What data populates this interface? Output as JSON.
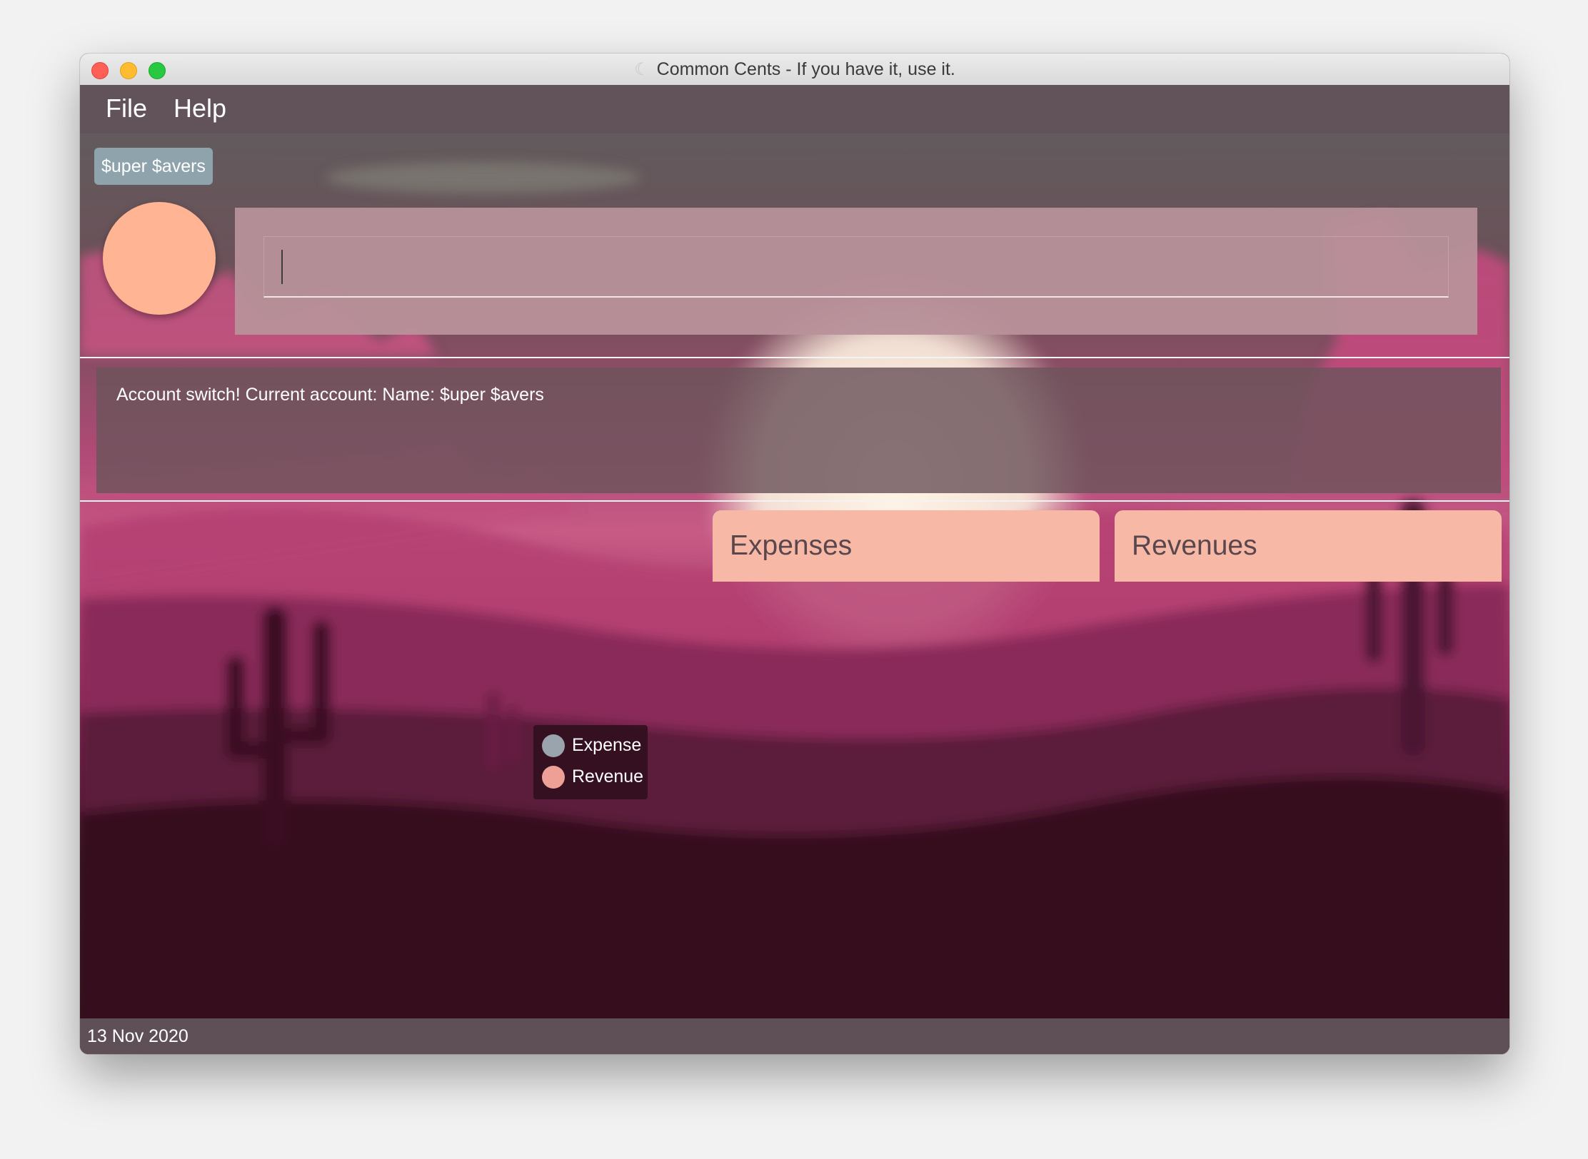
{
  "window": {
    "title": "Common Cents - If you have it, use it."
  },
  "menu": {
    "file": "File",
    "help": "Help"
  },
  "account": {
    "name": "$uper $avers"
  },
  "command": {
    "value": ""
  },
  "result": {
    "message": "Account switch! Current account: Name: $uper $avers"
  },
  "lists": {
    "expenses_header": "Expenses",
    "revenues_header": "Revenues"
  },
  "legend": {
    "items": [
      {
        "label": "Expense",
        "color": "#9aa4ac"
      },
      {
        "label": "Revenue",
        "color": "#eea097"
      }
    ]
  },
  "status": {
    "date": "13 Nov 2020"
  },
  "colors": {
    "menubar": "#625259",
    "account_tag": "#8fa3ad",
    "avatar": "#ffb493",
    "command_box": "#b8919a",
    "list_header": "#f8b8a6",
    "header_text": "#59474d"
  }
}
